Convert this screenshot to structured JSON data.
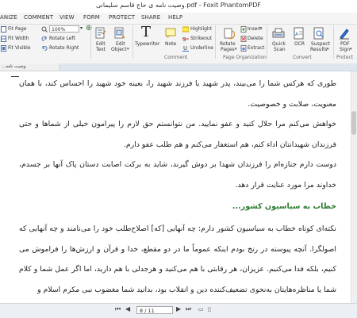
{
  "window": {
    "title": "وصیت نامه ی حاج قاسم سلیمانی.pdf - Foxit PhantomPDF"
  },
  "menu": {
    "items": [
      "ANIZE",
      "COMMENT",
      "VIEW",
      "FORM",
      "PROTECT",
      "SHARE",
      "HELP"
    ]
  },
  "ribbon": {
    "fit_page": "Fit Page",
    "fit_width": "Fit Width",
    "fit_visible": "Fit Visible",
    "zoom_value": "100%",
    "rotate_left": "Rotate Left",
    "rotate_right": "Rotate Right",
    "edit_text": [
      "Edit",
      "Text"
    ],
    "edit_object": [
      "Edit",
      "Object"
    ],
    "typewriter": "Typewriter",
    "note": "Note",
    "highlight": "Highlight",
    "strikeout": "Strikeout",
    "underline": "Underline",
    "rotate_pages": [
      "Rotate",
      "Pages"
    ],
    "insert": "Insert",
    "delete": "Delete",
    "extract": "Extract",
    "quick_scan": [
      "Quick",
      "Scan"
    ],
    "ocr": [
      "OCR"
    ],
    "suspect_results": [
      "Suspect",
      "Results"
    ],
    "pdf_sign": [
      "PDF",
      "Sign"
    ],
    "groups": {
      "comment": "Comment",
      "page_organization": "Page Organization",
      "convert": "Convert",
      "protect": "Protect"
    }
  },
  "document_tab": {
    "label": "...وصیت نامه"
  },
  "document": {
    "paragraph1": "طوری که هرکس شما را می‌بیند، پدر شهید یا فرزند شهید را، بعینه خود شهید را احساس کند، با همان معنویت، صلابت و خصوصیت.",
    "paragraph2": "خواهش می‌کنم مرا حلال کنید و عفو نمایید. من نتوانستم حق لازم را پیرامون خیلی از شماها و حتی فرزندان شهیدانتان اداء کنم، هم استغفار می‌کنم و هم طلب عفو دارم.",
    "paragraph3": "دوست دارم جنازه‌ام را فرزندان شهدا بر دوش گیرند، شاید به برکت اصابت دستان پاک آنها بر جسدم، خداوند مرا مورد عنایت قرار دهد.",
    "heading": "خطاب به سیاسیون کشور...",
    "paragraph4": "نکته‌ای کوتاه خطاب به سیاسیون کشور دارم: چه آنهایی [که] اصلاح‌طلب خود را می‌نامند و چه آنهایی که اصولگرا. آنچه پیوسته در رنج بودم اینکه عموماً ما در دو مقطع، خدا و قرآن و ارزش‌ها را فراموش می کنیم، بلکه فدا می‌کنیم. عزیزان، هر رقابتی با هم می‌کنید و هرجدلی با هم دارید، اما اگر عمل شما و کلام شما یا مناظره‌هایتان به‌نحوی تضعیف‌کننده دین و انقلاب بود، بدانید شما مغضوب نبی مکرم اسلام و"
  },
  "statusbar": {
    "page_indicator": "8 / 11"
  }
}
